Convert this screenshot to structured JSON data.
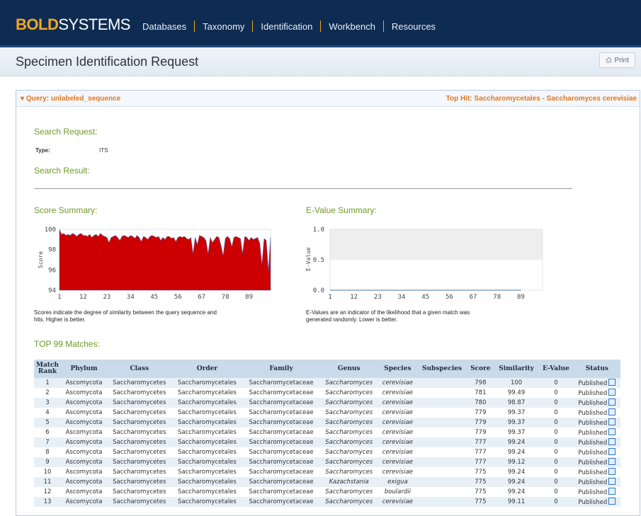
{
  "header": {
    "logo_bold": "BOLD",
    "logo_rest": "SYSTEMS",
    "nav": [
      "Databases",
      "Taxonomy",
      "Identification",
      "Workbench",
      "Resources"
    ]
  },
  "page": {
    "title": "Specimen Identification Request",
    "print_label": "Print"
  },
  "panel": {
    "query": "Query: unlabeled_sequence",
    "top_hit": "Top Hit: Saccharomycetales - Saccharomyces cerevisiae"
  },
  "request": {
    "search_request_label": "Search Request:",
    "type_label": "Type:",
    "type_value": "ITS",
    "search_result_label": "Search Result:"
  },
  "score_chart": {
    "heading": "Score Summary:",
    "caption": "Scores indicate the degree of similarity between the query sequence and hits. Higher is better."
  },
  "evalue_chart": {
    "heading": "E-Value Summary:",
    "caption": "E-Values are an indicator of the likelihood that a given match was generated randomly. Lower is better."
  },
  "chart_data": [
    {
      "type": "area",
      "title": "",
      "xlabel": "",
      "ylabel": "Score",
      "x_ticks": [
        1,
        12,
        23,
        34,
        45,
        56,
        67,
        78,
        89
      ],
      "y_ticks": [
        94,
        96,
        98,
        100
      ],
      "ylim": [
        94,
        100
      ],
      "xlim": [
        1,
        99
      ],
      "series": [
        {
          "values": [
            100,
            99.5,
            99.6,
            99.4,
            99.5,
            99.4,
            99.6,
            99.5,
            99.3,
            99.5,
            99.6,
            99.4,
            99.4,
            99.3,
            99.5,
            99.2,
            99.4,
            99.5,
            99.3,
            99.6,
            99.4,
            99.3,
            99.2,
            98.7,
            99.2,
            99.3,
            99.4,
            99.2,
            98.9,
            99.3,
            99.4,
            99.3,
            99.2,
            99.4,
            99.3,
            99.1,
            99.4,
            99.2,
            98.8,
            99.3,
            99.2,
            99.0,
            99.3,
            99.4,
            99.3,
            99.2,
            99.3,
            98.9,
            99.2,
            99.0,
            99.3,
            99.3,
            99.1,
            99.2,
            98.8,
            99.2,
            99.3,
            99.2,
            99.3,
            99.1,
            99.0,
            99.2,
            97.6,
            99.2,
            98.5,
            99.4,
            99.3,
            99.2,
            98.9,
            97.6,
            99.2,
            98.7,
            99.0,
            99.3,
            99.2,
            98.4,
            97.4,
            99.1,
            99.3,
            99.1,
            98.3,
            99.2,
            99.3,
            99.2,
            99.1,
            97.6,
            99.3,
            99.2,
            98.9,
            99.2,
            99.0,
            99.1,
            99.2,
            98.6,
            96.5,
            99.1,
            98.9,
            95.9,
            99.2
          ]
        }
      ]
    },
    {
      "type": "line",
      "title": "",
      "xlabel": "",
      "ylabel": "E-Value",
      "x_ticks": [
        1,
        12,
        23,
        34,
        45,
        56,
        67,
        78,
        89
      ],
      "y_ticks": [
        "0.0",
        "0.5",
        "1.0"
      ],
      "ylim": [
        0,
        1
      ],
      "xlim": [
        1,
        99
      ],
      "series": [
        {
          "values": [
            0,
            0,
            0,
            0,
            0,
            0,
            0,
            0,
            0
          ]
        }
      ]
    }
  ],
  "matches": {
    "heading": "TOP 99 Matches:",
    "columns": [
      "Match Rank",
      "Phylum",
      "Class",
      "Order",
      "Family",
      "Genus",
      "Species",
      "Subspecies",
      "Score",
      "Similarity",
      "E-Value",
      "Status"
    ],
    "rows": [
      [
        "1",
        "Ascomycota",
        "Saccharomycetes",
        "Saccharomycetales",
        "Saccharomycetaceae",
        "Saccharomyces",
        "cerevisiae",
        "",
        "798",
        "100",
        "0",
        "Published"
      ],
      [
        "2",
        "Ascomycota",
        "Saccharomycetes",
        "Saccharomycetales",
        "Saccharomycetaceae",
        "Saccharomyces",
        "cerevisiae",
        "",
        "781",
        "99.49",
        "0",
        "Published"
      ],
      [
        "3",
        "Ascomycota",
        "Saccharomycetes",
        "Saccharomycetales",
        "Saccharomycetaceae",
        "Saccharomyces",
        "cerevisiae",
        "",
        "780",
        "98.87",
        "0",
        "Published"
      ],
      [
        "4",
        "Ascomycota",
        "Saccharomycetes",
        "Saccharomycetales",
        "Saccharomycetaceae",
        "Saccharomyces",
        "cerevisiae",
        "",
        "779",
        "99.37",
        "0",
        "Published"
      ],
      [
        "5",
        "Ascomycota",
        "Saccharomycetes",
        "Saccharomycetales",
        "Saccharomycetaceae",
        "Saccharomyces",
        "cerevisiae",
        "",
        "779",
        "99.37",
        "0",
        "Published"
      ],
      [
        "6",
        "Ascomycota",
        "Saccharomycetes",
        "Saccharomycetales",
        "Saccharomycetaceae",
        "Saccharomyces",
        "cerevisiae",
        "",
        "779",
        "99.37",
        "0",
        "Published"
      ],
      [
        "7",
        "Ascomycota",
        "Saccharomycetes",
        "Saccharomycetales",
        "Saccharomycetaceae",
        "Saccharomyces",
        "cerevisiae",
        "",
        "777",
        "99.24",
        "0",
        "Published"
      ],
      [
        "8",
        "Ascomycota",
        "Saccharomycetes",
        "Saccharomycetales",
        "Saccharomycetaceae",
        "Saccharomyces",
        "cerevisiae",
        "",
        "777",
        "99.24",
        "0",
        "Published"
      ],
      [
        "9",
        "Ascomycota",
        "Saccharomycetes",
        "Saccharomycetales",
        "Saccharomycetaceae",
        "Saccharomyces",
        "cerevisiae",
        "",
        "777",
        "99.12",
        "0",
        "Published"
      ],
      [
        "10",
        "Ascomycota",
        "Saccharomycetes",
        "Saccharomycetales",
        "Saccharomycetaceae",
        "Saccharomyces",
        "cerevisiae",
        "",
        "775",
        "99.24",
        "0",
        "Published"
      ],
      [
        "11",
        "Ascomycota",
        "Saccharomycetes",
        "Saccharomycetales",
        "Saccharomycetaceae",
        "Kazachstania",
        "exigua",
        "",
        "775",
        "99.24",
        "0",
        "Published"
      ],
      [
        "12",
        "Ascomycota",
        "Saccharomycetes",
        "Saccharomycetales",
        "Saccharomycetaceae",
        "Saccharomyces",
        "boulardii",
        "",
        "775",
        "99.24",
        "0",
        "Published"
      ],
      [
        "13",
        "Ascomycota",
        "Saccharomycetes",
        "Saccharomycetales",
        "Saccharomycetaceae",
        "Saccharomyces",
        "cerevisiae",
        "",
        "775",
        "99.11",
        "0",
        "Published"
      ]
    ]
  },
  "colors": {
    "header_bg": "#0e2c52",
    "logo_accent": "#f5a623",
    "green_heading": "#6f9a2b",
    "orange_link": "#e2761e",
    "score_fill": "#cc0000"
  },
  "icons": {
    "print": "printer-icon",
    "collapse": "caret-down-icon",
    "external": "external-link-icon"
  }
}
